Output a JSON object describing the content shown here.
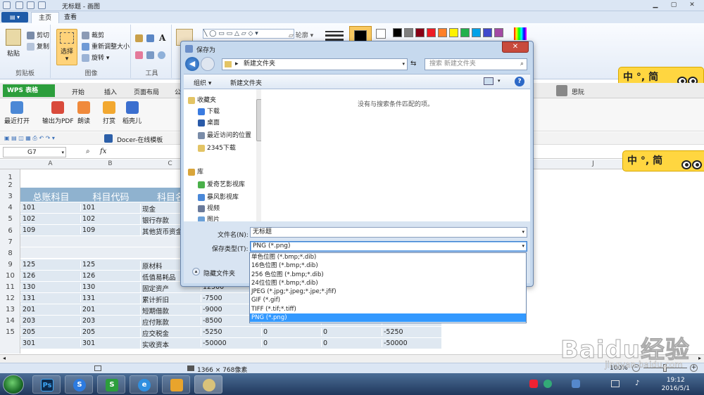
{
  "window": {
    "title": "无标题 - 画图"
  },
  "paint_tabs": {
    "menu": "▤ ▾",
    "home": "主页",
    "view": "查看"
  },
  "paint_ribbon": {
    "clipboard": {
      "paste": "粘贴",
      "cut": "剪切",
      "copy": "复制",
      "label": "剪贴板"
    },
    "image": {
      "select": "选择",
      "crop": "裁剪",
      "resize": "重新调整大小",
      "rotate": "旋转",
      "label": "图像"
    },
    "tools": {
      "label": "工具",
      "text_tool": "A"
    },
    "shapes": {
      "outline": "轮廓"
    },
    "colors": [
      "#000000",
      "#7f7f7f",
      "#880015",
      "#ed1c24",
      "#ff7f27",
      "#fff200",
      "#22b14c",
      "#00a2e8",
      "#3f48cc",
      "#a349a4",
      "#ffffff"
    ],
    "color1": "#000000",
    "color2": "#ffffff"
  },
  "ime": {
    "text": "中 °, 简"
  },
  "wps": {
    "logo": "WPS 表格",
    "tabs": [
      "开始",
      "插入",
      "页面布局",
      "公"
    ],
    "user": "思阮",
    "tools": [
      "最近打开",
      "输出为PDF",
      "朗读",
      "打赏",
      "稻壳儿"
    ],
    "template": "Docer-在线模板",
    "cell_ref": "G7",
    "fx": "fx"
  },
  "sheet": {
    "columns": [
      "A",
      "B",
      "C",
      "J"
    ],
    "rows": [
      "1",
      "2",
      "3",
      "4",
      "5",
      "6",
      "7",
      "8",
      "9",
      "10",
      "11",
      "12",
      "13",
      "14",
      "15"
    ],
    "header": [
      "总账科目",
      "科目代码",
      "科目名"
    ],
    "data": [
      [
        "101",
        "101",
        "现金",
        "",
        "",
        "",
        ""
      ],
      [
        "102",
        "102",
        "银行存款",
        "",
        "",
        "",
        ""
      ],
      [
        "109",
        "109",
        "其他货币资金",
        "",
        "",
        "",
        ""
      ],
      [
        "",
        "",
        "",
        "",
        "",
        "",
        ""
      ],
      [
        "",
        "",
        "",
        "",
        "",
        "",
        ""
      ],
      [
        "125",
        "125",
        "原材料",
        "",
        "",
        "",
        ""
      ],
      [
        "126",
        "126",
        "低值易耗品",
        "",
        "",
        "",
        ""
      ],
      [
        "130",
        "130",
        "固定资产",
        "12500",
        "",
        "",
        ""
      ],
      [
        "131",
        "131",
        "累计折旧",
        "-7500",
        "",
        "",
        ""
      ],
      [
        "201",
        "201",
        "短期借款",
        "-9000",
        "",
        "",
        ""
      ],
      [
        "203",
        "203",
        "应付账款",
        "-8500",
        "0",
        "2000",
        "-10500"
      ],
      [
        "205",
        "205",
        "应交税金",
        "-5250",
        "0",
        "0",
        "-5250"
      ],
      [
        "301",
        "301",
        "实收资本",
        "-50000",
        "0",
        "0",
        "-50000"
      ]
    ]
  },
  "dialog": {
    "title": "保存为",
    "path": "新建文件夹",
    "search": "搜索 新建文件夹",
    "organize": "组织 ▾",
    "new_folder": "新建文件夹",
    "empty": "没有与搜索条件匹配的项。",
    "nav": [
      "收藏夹",
      "下载",
      "桌面",
      "最近访问的位置",
      "2345下载",
      "库",
      "爱奇艺影视库",
      "暴风影视库",
      "视频",
      "图片"
    ],
    "filename_label": "文件名(N):",
    "filename": "无标题",
    "type_label": "保存类型(T):",
    "type": "PNG (*.png)",
    "hide": "隐藏文件夹",
    "type_options": [
      "单色位图 (*.bmp;*.dib)",
      "16色位图 (*.bmp;*.dib)",
      "256 色位图 (*.bmp;*.dib)",
      "24位位图 (*.bmp;*.dib)",
      "JPEG (*.jpg;*.jpeg;*.jpe;*.jfif)",
      "GIF (*.gif)",
      "TIFF (*.tif;*.tiff)",
      "PNG (*.png)"
    ]
  },
  "status": {
    "size": "1366 × 768像素",
    "zoom": "100%"
  },
  "taskbar": {
    "time": "19:12",
    "date": "2016/5/1",
    "apps": [
      "Ps",
      "S",
      "S",
      "e",
      "",
      ""
    ]
  },
  "watermark": {
    "brand": "Baidu经验",
    "url": "jingyan.baidu.com"
  }
}
